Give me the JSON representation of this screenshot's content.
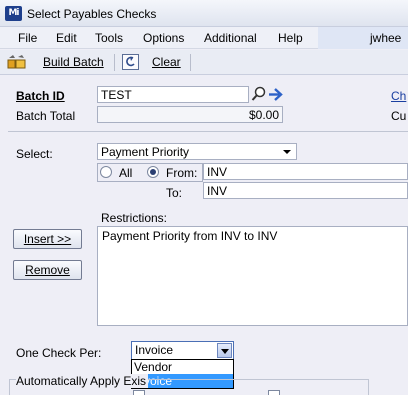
{
  "window": {
    "title": "Select Payables Checks",
    "app_icon": "Mi"
  },
  "menu": [
    "File",
    "Edit",
    "Tools",
    "Options",
    "Additional",
    "Help"
  ],
  "user": "jwhee",
  "toolbar": {
    "build_batch": "Build Batch",
    "clear": "Clear"
  },
  "batch": {
    "id_label": "Batch ID",
    "id_value": "TEST",
    "total_label": "Batch Total",
    "total_value": "$0.00",
    "right_link": "Ch",
    "right_label": "Cu"
  },
  "select": {
    "label": "Select:",
    "value": "Payment Priority"
  },
  "range": {
    "all_label": "All",
    "from_label": "From:",
    "from_value": "INV",
    "to_label": "To:",
    "to_value": "INV"
  },
  "restrictions": {
    "label": "Restrictions:",
    "items": [
      "Payment Priority from INV to INV"
    ]
  },
  "buttons": {
    "insert": "Insert >>",
    "remove": "Remove"
  },
  "one_check": {
    "label": "One Check Per:",
    "value": "Invoice",
    "options": [
      "Vendor",
      "Invoice"
    ],
    "selected_index": 1
  },
  "auto_apply": {
    "label": "Automatically Apply Exis"
  }
}
